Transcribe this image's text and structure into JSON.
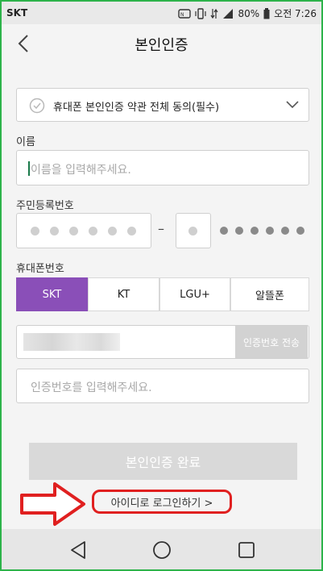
{
  "status_bar": {
    "carrier": "SKT",
    "battery": "80%",
    "time": "오전 7:26"
  },
  "header": {
    "title": "본인인증"
  },
  "agreement": {
    "label": "휴대폰 본인인증 약관 전체 동의(필수)"
  },
  "name": {
    "label": "이름",
    "placeholder": "이름을 입력해주세요."
  },
  "resident": {
    "label": "주민등록번호",
    "separator": "–"
  },
  "phone": {
    "label": "휴대폰번호",
    "carriers": [
      "SKT",
      "KT",
      "LGU+",
      "알뜰폰"
    ],
    "selected": "SKT",
    "send_button": "인증번호 전송"
  },
  "verify": {
    "placeholder": "인증번호를 입력해주세요."
  },
  "complete_button": "본인인증 완료",
  "id_login_link": "아이디로 로그인하기  >",
  "colors": {
    "accent": "#8a4fb8",
    "annotation": "#e02020",
    "frame": "#2db34a"
  }
}
